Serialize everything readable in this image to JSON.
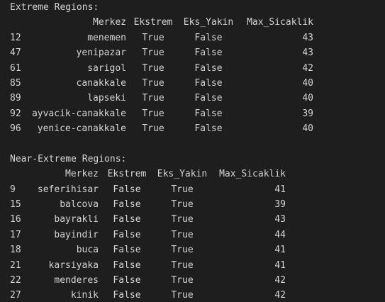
{
  "extreme": {
    "title": "Extreme Regions:",
    "columns": [
      "Merkez",
      "Ekstrem",
      "Eks_Yakin",
      "Max_Sicaklik"
    ],
    "rows": [
      {
        "idx": "12",
        "merkez": "menemen",
        "ekstrem": "True",
        "eks_yakin": "False",
        "max": "43"
      },
      {
        "idx": "47",
        "merkez": "yenipazar",
        "ekstrem": "True",
        "eks_yakin": "False",
        "max": "43"
      },
      {
        "idx": "61",
        "merkez": "sarigol",
        "ekstrem": "True",
        "eks_yakin": "False",
        "max": "42"
      },
      {
        "idx": "85",
        "merkez": "canakkale",
        "ekstrem": "True",
        "eks_yakin": "False",
        "max": "40"
      },
      {
        "idx": "89",
        "merkez": "lapseki",
        "ekstrem": "True",
        "eks_yakin": "False",
        "max": "40"
      },
      {
        "idx": "92",
        "merkez": "ayvacik-canakkale",
        "ekstrem": "True",
        "eks_yakin": "False",
        "max": "39"
      },
      {
        "idx": "96",
        "merkez": "yenice-canakkale",
        "ekstrem": "True",
        "eks_yakin": "False",
        "max": "40"
      }
    ]
  },
  "near_extreme": {
    "title": "Near-Extreme Regions:",
    "columns": [
      "Merkez",
      "Ekstrem",
      "Eks_Yakin",
      "Max_Sicaklik"
    ],
    "rows": [
      {
        "idx": "9",
        "merkez": "seferihisar",
        "ekstrem": "False",
        "eks_yakin": "True",
        "max": "41"
      },
      {
        "idx": "15",
        "merkez": "balcova",
        "ekstrem": "False",
        "eks_yakin": "True",
        "max": "39"
      },
      {
        "idx": "16",
        "merkez": "bayrakli",
        "ekstrem": "False",
        "eks_yakin": "True",
        "max": "43"
      },
      {
        "idx": "17",
        "merkez": "bayindir",
        "ekstrem": "False",
        "eks_yakin": "True",
        "max": "44"
      },
      {
        "idx": "18",
        "merkez": "buca",
        "ekstrem": "False",
        "eks_yakin": "True",
        "max": "41"
      },
      {
        "idx": "21",
        "merkez": "karsiyaka",
        "ekstrem": "False",
        "eks_yakin": "True",
        "max": "41"
      },
      {
        "idx": "22",
        "merkez": "menderes",
        "ekstrem": "False",
        "eks_yakin": "True",
        "max": "42"
      },
      {
        "idx": "27",
        "merkez": "kinik",
        "ekstrem": "False",
        "eks_yakin": "True",
        "max": "42"
      }
    ]
  }
}
